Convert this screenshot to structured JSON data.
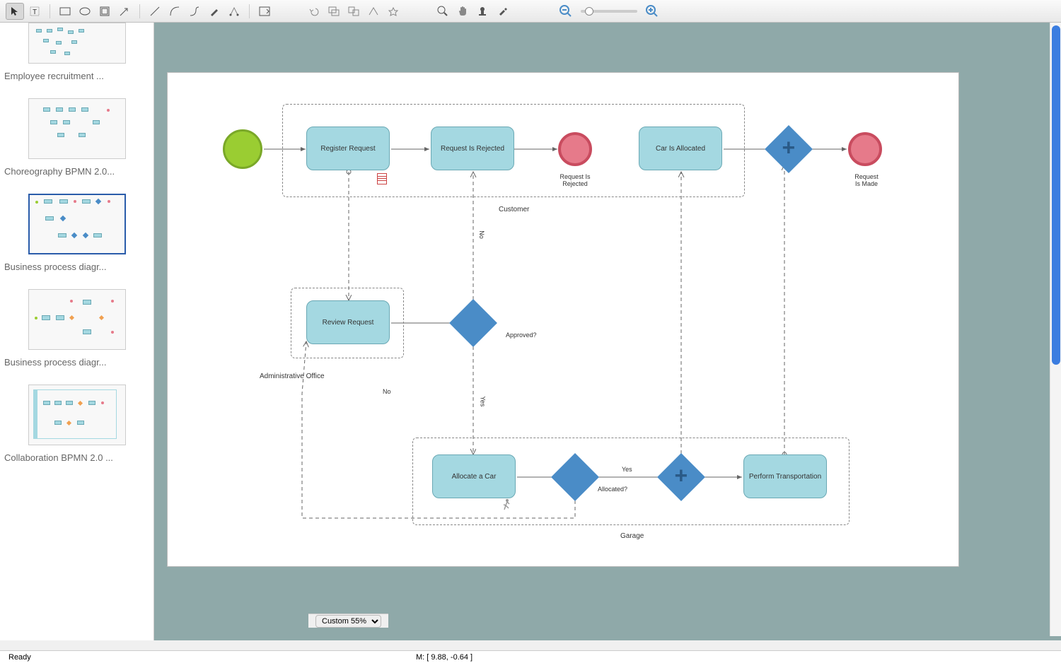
{
  "toolbar": {
    "tools": [
      "select",
      "text",
      "rect",
      "ellipse",
      "container",
      "arrow",
      "line",
      "curve",
      "connector",
      "pen",
      "anchor",
      "insert"
    ]
  },
  "sidebar": {
    "items": [
      {
        "label": "Employee recruitment ..."
      },
      {
        "label": "Choreography BPMN 2.0..."
      },
      {
        "label": "Business process diagr..."
      },
      {
        "label": "Business process diagr..."
      },
      {
        "label": "Collaboration BPMN 2.0 ..."
      }
    ]
  },
  "diagram": {
    "pools": [
      {
        "name": "Customer",
        "label": "Customer"
      },
      {
        "name": "AdministrativeOffice",
        "label": "Administrative Office"
      },
      {
        "name": "Garage",
        "label": "Garage"
      }
    ],
    "tasks": {
      "register": "Register Request",
      "requestRejected": "Request Is Rejected",
      "carAllocated": "Car Is Allocated",
      "review": "Review Request",
      "allocate": "Allocate a Car",
      "perform": "Perform Transportation"
    },
    "gateways": {
      "approved": "Approved?",
      "allocated": "Allocated?"
    },
    "events": {
      "rejectedEnd": "Request Is Rejected",
      "requestMade": "Request\nIs Made"
    },
    "edges": {
      "no": "No",
      "yes": "Yes",
      "noVert": "No",
      "yesVert": "Yes"
    }
  },
  "zoom": {
    "selected": "Custom 55%"
  },
  "status": {
    "ready": "Ready",
    "coords": "M: [ 9.88, -0.64 ]"
  }
}
